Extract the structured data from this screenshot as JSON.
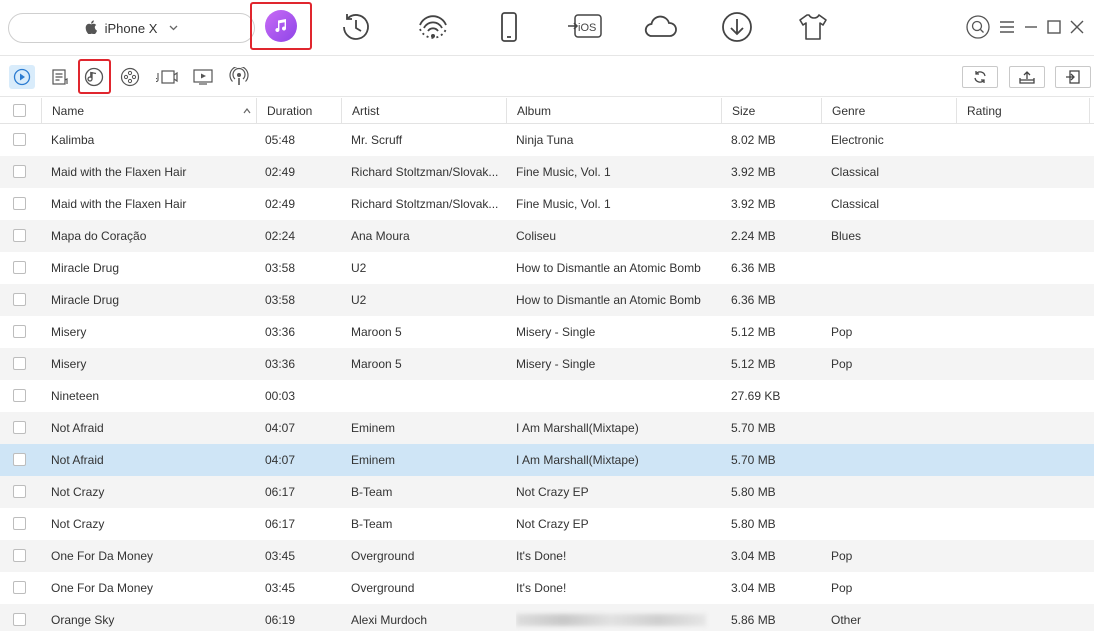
{
  "device": {
    "name": "iPhone X"
  },
  "top_nav": [
    {
      "icon": "music-icon"
    },
    {
      "icon": "history-clock-icon"
    },
    {
      "icon": "wifi-transfer-icon"
    },
    {
      "icon": "phone-icon"
    },
    {
      "icon": "ios-transfer-icon",
      "label": "iOS"
    },
    {
      "icon": "cloud-icon"
    },
    {
      "icon": "download-icon"
    },
    {
      "icon": "tshirt-icon"
    }
  ],
  "columns": {
    "name": "Name",
    "duration": "Duration",
    "artist": "Artist",
    "album": "Album",
    "size": "Size",
    "genre": "Genre",
    "rating": "Rating"
  },
  "rows": [
    {
      "name": "Kalimba",
      "duration": "05:48",
      "artist": "Mr. Scruff",
      "album": "Ninja Tuna",
      "size": "8.02 MB",
      "genre": "Electronic"
    },
    {
      "name": "Maid with the Flaxen Hair",
      "duration": "02:49",
      "artist": "Richard Stoltzman/Slovak...",
      "album": "Fine Music, Vol. 1",
      "size": "3.92 MB",
      "genre": "Classical"
    },
    {
      "name": "Maid with the Flaxen Hair",
      "duration": "02:49",
      "artist": "Richard Stoltzman/Slovak...",
      "album": "Fine Music, Vol. 1",
      "size": "3.92 MB",
      "genre": "Classical"
    },
    {
      "name": "Mapa do Coração",
      "duration": "02:24",
      "artist": "Ana Moura",
      "album": "Coliseu",
      "size": "2.24 MB",
      "genre": "Blues"
    },
    {
      "name": "Miracle Drug",
      "duration": "03:58",
      "artist": "U2",
      "album": "How to Dismantle an Atomic Bomb",
      "size": "6.36 MB",
      "genre": ""
    },
    {
      "name": "Miracle Drug",
      "duration": "03:58",
      "artist": "U2",
      "album": "How to Dismantle an Atomic Bomb",
      "size": "6.36 MB",
      "genre": ""
    },
    {
      "name": "Misery",
      "duration": "03:36",
      "artist": "Maroon 5",
      "album": "Misery - Single",
      "size": "5.12 MB",
      "genre": "Pop"
    },
    {
      "name": "Misery",
      "duration": "03:36",
      "artist": "Maroon 5",
      "album": "Misery - Single",
      "size": "5.12 MB",
      "genre": "Pop"
    },
    {
      "name": "Nineteen",
      "duration": "00:03",
      "artist": "",
      "album": "",
      "size": "27.69 KB",
      "genre": ""
    },
    {
      "name": "Not Afraid",
      "duration": "04:07",
      "artist": "Eminem",
      "album": "I Am Marshall(Mixtape)",
      "size": "5.70 MB",
      "genre": ""
    },
    {
      "name": "Not Afraid",
      "duration": "04:07",
      "artist": "Eminem",
      "album": "I Am Marshall(Mixtape)",
      "size": "5.70 MB",
      "genre": ""
    },
    {
      "name": "Not Crazy",
      "duration": "06:17",
      "artist": "B-Team",
      "album": "Not Crazy EP",
      "size": "5.80 MB",
      "genre": ""
    },
    {
      "name": "Not Crazy",
      "duration": "06:17",
      "artist": "B-Team",
      "album": "Not Crazy EP",
      "size": "5.80 MB",
      "genre": ""
    },
    {
      "name": "One For Da Money",
      "duration": "03:45",
      "artist": "Overground",
      "album": "It's Done!",
      "size": "3.04 MB",
      "genre": "Pop"
    },
    {
      "name": "One For Da Money",
      "duration": "03:45",
      "artist": "Overground",
      "album": "It's Done!",
      "size": "3.04 MB",
      "genre": "Pop"
    },
    {
      "name": "Orange Sky",
      "duration": "06:19",
      "artist": "Alexi Murdoch",
      "album": "",
      "size": "5.86 MB",
      "genre": "Other"
    }
  ],
  "selected_row": 10,
  "colors": {
    "accent": "#e0262e",
    "selected_row": "#cfe5f6",
    "music_gradient_start": "#c86bf5",
    "music_gradient_end": "#8e45e8"
  }
}
